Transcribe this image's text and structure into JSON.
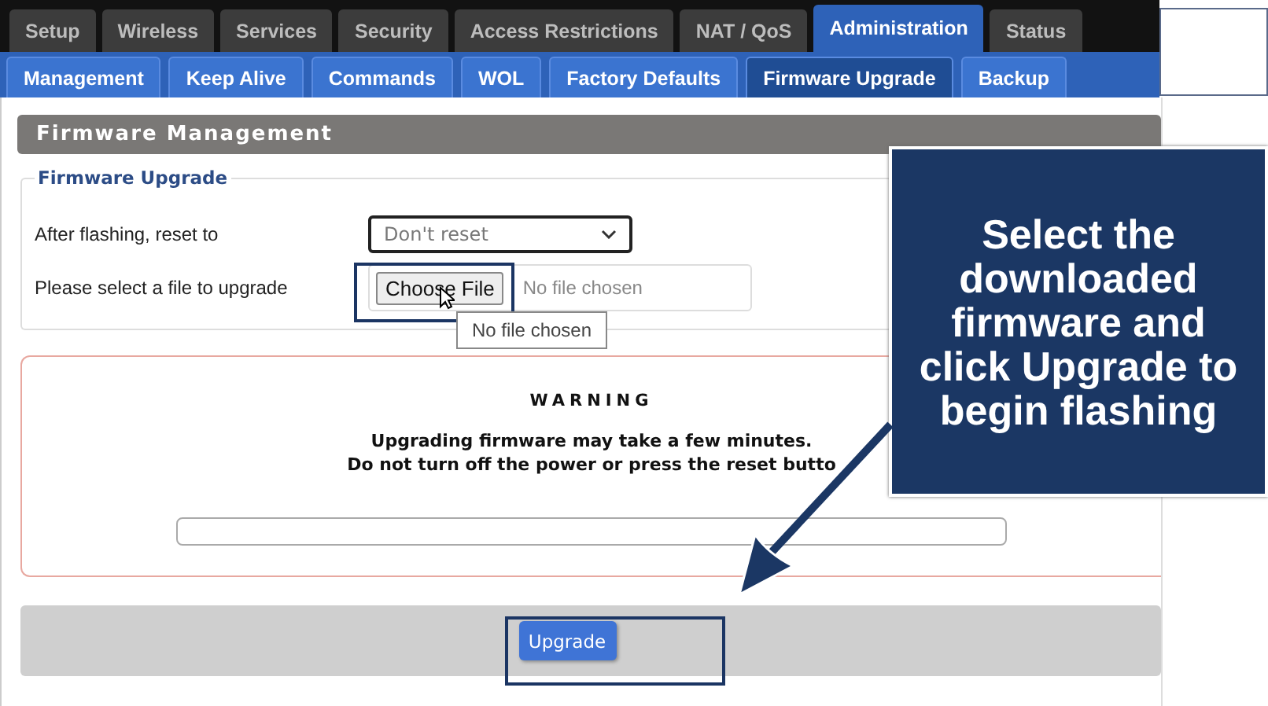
{
  "tabs": [
    {
      "label": "Setup",
      "selected": false
    },
    {
      "label": "Wireless",
      "selected": false
    },
    {
      "label": "Services",
      "selected": false
    },
    {
      "label": "Security",
      "selected": false
    },
    {
      "label": "Access Restrictions",
      "selected": false
    },
    {
      "label": "NAT / QoS",
      "selected": false
    },
    {
      "label": "Administration",
      "selected": true
    },
    {
      "label": "Status",
      "selected": false
    }
  ],
  "subtabs": [
    {
      "label": "Management",
      "selected": false
    },
    {
      "label": "Keep Alive",
      "selected": false
    },
    {
      "label": "Commands",
      "selected": false
    },
    {
      "label": "WOL",
      "selected": false
    },
    {
      "label": "Factory Defaults",
      "selected": false
    },
    {
      "label": "Firmware Upgrade",
      "selected": true
    },
    {
      "label": "Backup",
      "selected": false
    }
  ],
  "section_title": "Firmware Management",
  "fieldset": {
    "legend": "Firmware Upgrade",
    "reset_label": "After flashing, reset to",
    "reset_value": "Don't reset",
    "file_label": "Please select a file to upgrade",
    "file_button": "Choose File",
    "file_status": "No file chosen",
    "tooltip": "No file chosen"
  },
  "warning": {
    "title": "WARNING",
    "lines": [
      "Upgrading firmware may take a few minutes.",
      "Do not turn off the power or press the reset butto"
    ],
    "progress": {
      "level": 0
    }
  },
  "upgrade_button": "Upgrade",
  "callout": {
    "text": "Select the downloaded firmware and click Upgrade to begin flashing"
  }
}
